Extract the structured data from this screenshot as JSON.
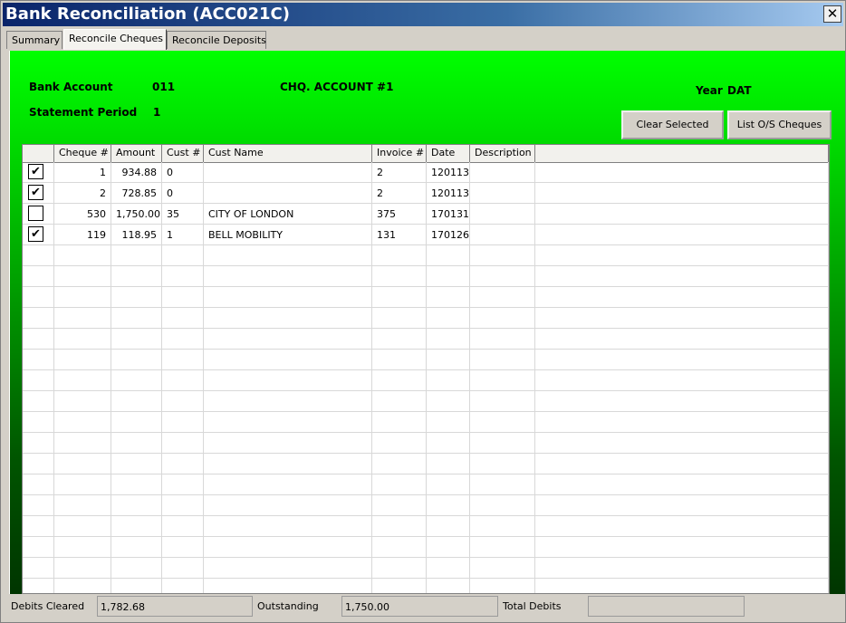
{
  "window": {
    "title": "Bank Reconciliation (ACC021C)",
    "close_glyph": "✕"
  },
  "tabs": [
    {
      "label": "Summary",
      "active": false
    },
    {
      "label": "Reconcile Cheques",
      "active": true
    },
    {
      "label": "Reconcile Deposits",
      "active": false
    }
  ],
  "header": {
    "bank_account_label": "Bank Account",
    "bank_account_value": "011",
    "account_name": "CHQ. ACCOUNT #1",
    "statement_period_label": "Statement Period",
    "statement_period_value": "1",
    "year_label": "Year",
    "year_value": "DAT"
  },
  "buttons": {
    "clear_selected": "Clear Selected",
    "list_os_cheques": "List O/S Cheques"
  },
  "grid": {
    "columns": [
      "",
      "Cheque #",
      "Amount",
      "Cust #",
      "Cust Name",
      "Invoice #",
      "Date",
      "Description",
      ""
    ],
    "rows": [
      {
        "checked": true,
        "cheque": "1",
        "amount": "934.88",
        "cust": "0",
        "cust_name": "",
        "invoice": "2",
        "date": "120113",
        "description": ""
      },
      {
        "checked": true,
        "cheque": "2",
        "amount": "728.85",
        "cust": "0",
        "cust_name": "",
        "invoice": "2",
        "date": "120113",
        "description": ""
      },
      {
        "checked": false,
        "cheque": "530",
        "amount": "1,750.00",
        "cust": "35",
        "cust_name": "CITY OF LONDON",
        "invoice": "375",
        "date": "170131",
        "description": ""
      },
      {
        "checked": true,
        "cheque": "119",
        "amount": "118.95",
        "cust": "1",
        "cust_name": "BELL MOBILITY",
        "invoice": "131",
        "date": "170126",
        "description": ""
      }
    ],
    "check_glyph": "✔"
  },
  "status": {
    "debits_cleared_label": "Debits Cleared",
    "debits_cleared_value": "1,782.68",
    "outstanding_label": "Outstanding",
    "outstanding_value": "1,750.00",
    "total_debits_label": "Total Debits",
    "total_debits_value": ""
  },
  "colors": {
    "title_bar": "#0a246a",
    "panel_top": "#00ff00",
    "panel_bottom": "#003500",
    "chrome": "#d4d0c8"
  }
}
